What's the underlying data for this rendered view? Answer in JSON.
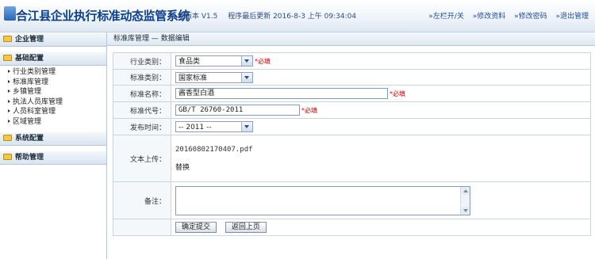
{
  "header": {
    "title": "合江县企业执行标准动态监管系统",
    "version": "系统版本 V1.5",
    "last_update": "程序最后更新 2016-8-3 上午 09:34:04",
    "links": [
      "»左栏开/关",
      "»修改资料",
      "»修改密码",
      "»退出管理"
    ]
  },
  "sidebar": {
    "groups": [
      {
        "label": "企业管理",
        "items": []
      },
      {
        "label": "基础配置",
        "items": [
          "行业类别管理",
          "标准库管理",
          "乡镇管理",
          "执法人员库管理",
          "人员科室管理",
          "区域管理"
        ]
      },
      {
        "label": "系统配置",
        "items": []
      },
      {
        "label": "帮助管理",
        "items": []
      }
    ]
  },
  "breadcrumb": "标准库管理 — 数据编辑",
  "form": {
    "industry_label": "行业类别：",
    "industry_value": "食品类",
    "standard_type_label": "标准类别：",
    "standard_type_value": "国家标准",
    "standard_name_label": "标准名称：",
    "standard_name_value": "酱香型白酒",
    "standard_code_label": "标准代号：",
    "standard_code_value": "GB/T 26760-2011",
    "publish_time_label": "发布时间：",
    "publish_time_value": "-- 2011 --",
    "upload_label": "文本上传：",
    "upload_file": "20160802170407.pdf",
    "replace_label": "替换",
    "remark_label": "备注：",
    "remark_value": "",
    "required_mark": "*必填",
    "submit_label": "确定提交",
    "back_label": "返回上页"
  },
  "colors": {
    "title": "#0b3e8c",
    "required": "#e00000",
    "link": "#1f4e97"
  }
}
